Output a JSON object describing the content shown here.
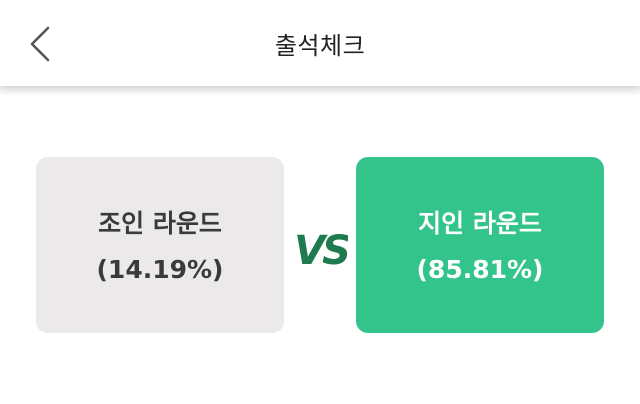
{
  "header": {
    "title": "출석체크"
  },
  "vote": {
    "left": {
      "name": "조인 라운드",
      "percent": "(14.19%)"
    },
    "right": {
      "name": "지인 라운드",
      "percent": "(85.81%)"
    },
    "vs_label": "VS"
  },
  "colors": {
    "accent": "#32c48a",
    "vs": "#1e7a4f",
    "left_card_bg": "#ece9eb"
  }
}
